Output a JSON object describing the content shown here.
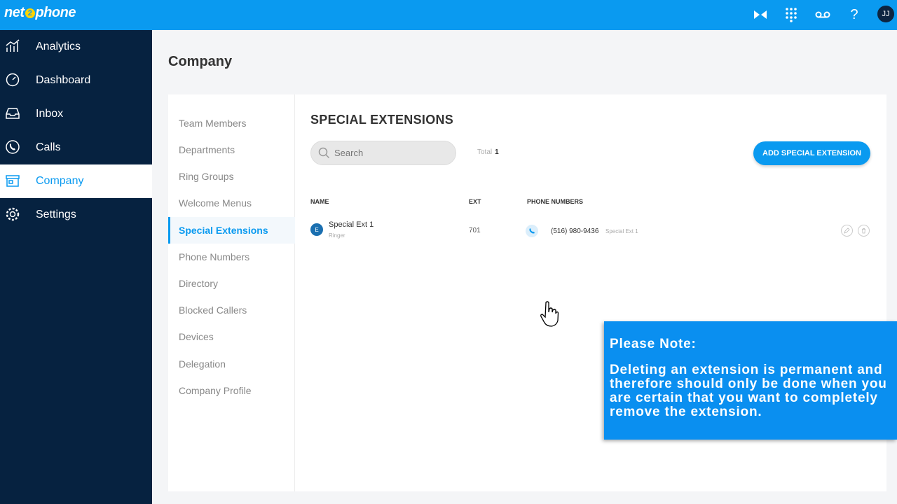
{
  "header": {
    "logo_text_a": "net",
    "logo_text_b": "2",
    "logo_text_c": "phone",
    "user_initials": "JJ",
    "icons": [
      "video-icon",
      "dialpad-icon",
      "voicemail-icon",
      "help-icon"
    ]
  },
  "sidebar": {
    "items": [
      {
        "label": "Analytics",
        "icon": "analytics-icon"
      },
      {
        "label": "Dashboard",
        "icon": "dashboard-icon"
      },
      {
        "label": "Inbox",
        "icon": "inbox-icon"
      },
      {
        "label": "Calls",
        "icon": "phone-icon"
      },
      {
        "label": "Company",
        "icon": "store-icon",
        "active": true
      },
      {
        "label": "Settings",
        "icon": "gear-icon"
      }
    ]
  },
  "page": {
    "title": "Company"
  },
  "subnav": {
    "items": [
      "Team Members",
      "Departments",
      "Ring Groups",
      "Welcome Menus",
      "Special Extensions",
      "Phone Numbers",
      "Directory",
      "Blocked Callers",
      "Devices",
      "Delegation",
      "Company Profile"
    ],
    "active": "Special Extensions"
  },
  "section": {
    "title": "SPECIAL EXTENSIONS",
    "search_placeholder": "Search",
    "total_label": "Total",
    "total_value": "1",
    "add_button": "ADD SPECIAL EXTENSION"
  },
  "table": {
    "headers": {
      "name": "NAME",
      "ext": "EXT",
      "phone": "PHONE NUMBERS"
    },
    "rows": [
      {
        "initial": "E",
        "name": "Special Ext 1",
        "type": "Ringer",
        "ext": "701",
        "phone": "(516) 980-9436",
        "phone_label": "Special Ext 1"
      }
    ]
  },
  "note": {
    "title": "Please Note:",
    "body": "Deleting an extension is permanent and therefore should only be done when you are certain that you want to completely remove the extension."
  },
  "colors": {
    "brand": "#0a9af0",
    "sidebar": "#062240",
    "note": "#0a8ff0"
  }
}
